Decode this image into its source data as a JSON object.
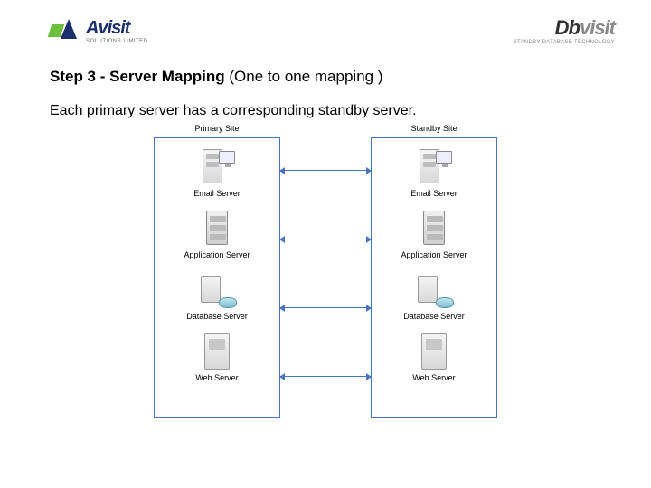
{
  "logos": {
    "left": {
      "brand": "Avisit",
      "tagline": "SOLUTIONS LIMITED"
    },
    "right": {
      "prefix": "Db",
      "suffix": "visit",
      "tagline": "STANDBY DATABASE TECHNOLOGY"
    }
  },
  "title": {
    "bold": "Step 3 - Server Mapping",
    "rest": " (One to one mapping )"
  },
  "subtitle": "Each primary server has a corresponding standby server.",
  "diagram": {
    "primary_label": "Primary Site",
    "standby_label": "Standby Site",
    "servers": [
      {
        "name": "Email Server"
      },
      {
        "name": "Application Server"
      },
      {
        "name": "Database Server"
      },
      {
        "name": "Web Server"
      }
    ]
  }
}
